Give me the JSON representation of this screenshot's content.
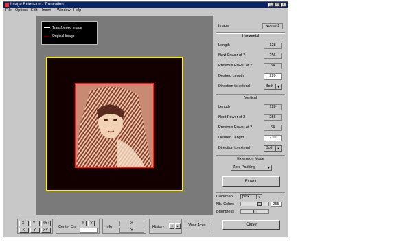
{
  "window": {
    "title": "Image Extension / Truncation",
    "buttons": {
      "minimize": "_",
      "maximize": "□",
      "close": "×"
    }
  },
  "menu": [
    "File",
    "Options",
    "Edit",
    "Insert",
    "Window",
    "Help"
  ],
  "legend": {
    "transformed": "Transformed Image",
    "original": "Original Image"
  },
  "colors": {
    "legend_transformed": "#ffffff",
    "legend_original": "#ff2020",
    "frame_outer": "#ffef00",
    "frame_inner": "#ff1a1a",
    "canvas_bg": "#120000",
    "axes_bg": "#7a7a7a"
  },
  "panel": {
    "image_label": "Image",
    "image_name": "woman2",
    "horizontal": {
      "title": "Horizontal",
      "length_label": "Length",
      "length": "128",
      "next_pow_label": "Next Power of 2",
      "next_pow": "256",
      "prev_pow_label": "Previous Power of 2",
      "prev_pow": "64",
      "desired_label": "Desired Length",
      "desired": "220",
      "direction_label": "Direction to extend",
      "direction": "Both"
    },
    "vertical": {
      "title": "Vertical",
      "length_label": "Length",
      "length": "128",
      "next_pow_label": "Next Power of 2",
      "next_pow": "256",
      "prev_pow_label": "Previous Power of 2",
      "prev_pow": "64",
      "desired_label": "Desired Length",
      "desired": "210",
      "direction_label": "Direction to extend",
      "direction": "Both"
    },
    "extension_mode": {
      "title": "Extension Mode",
      "value": "Zero Padding"
    },
    "extend_button": "Extend",
    "colormap_label": "Colormap",
    "colormap_value": "pink",
    "nb_colors_label": "Nb. Colors",
    "nb_colors_value": "255",
    "brightness_label": "Brightness",
    "close_button": "Close"
  },
  "bottom": {
    "xplus": "X+",
    "xminus": "X-",
    "xyplus": "XY+",
    "yplus": "Y+",
    "yminus": "Y-",
    "xyminus": "XY-",
    "center_on": "Center On",
    "x": "X",
    "y": "Y",
    "info": "Info",
    "history": "History",
    "view_axes": "View Axes"
  }
}
